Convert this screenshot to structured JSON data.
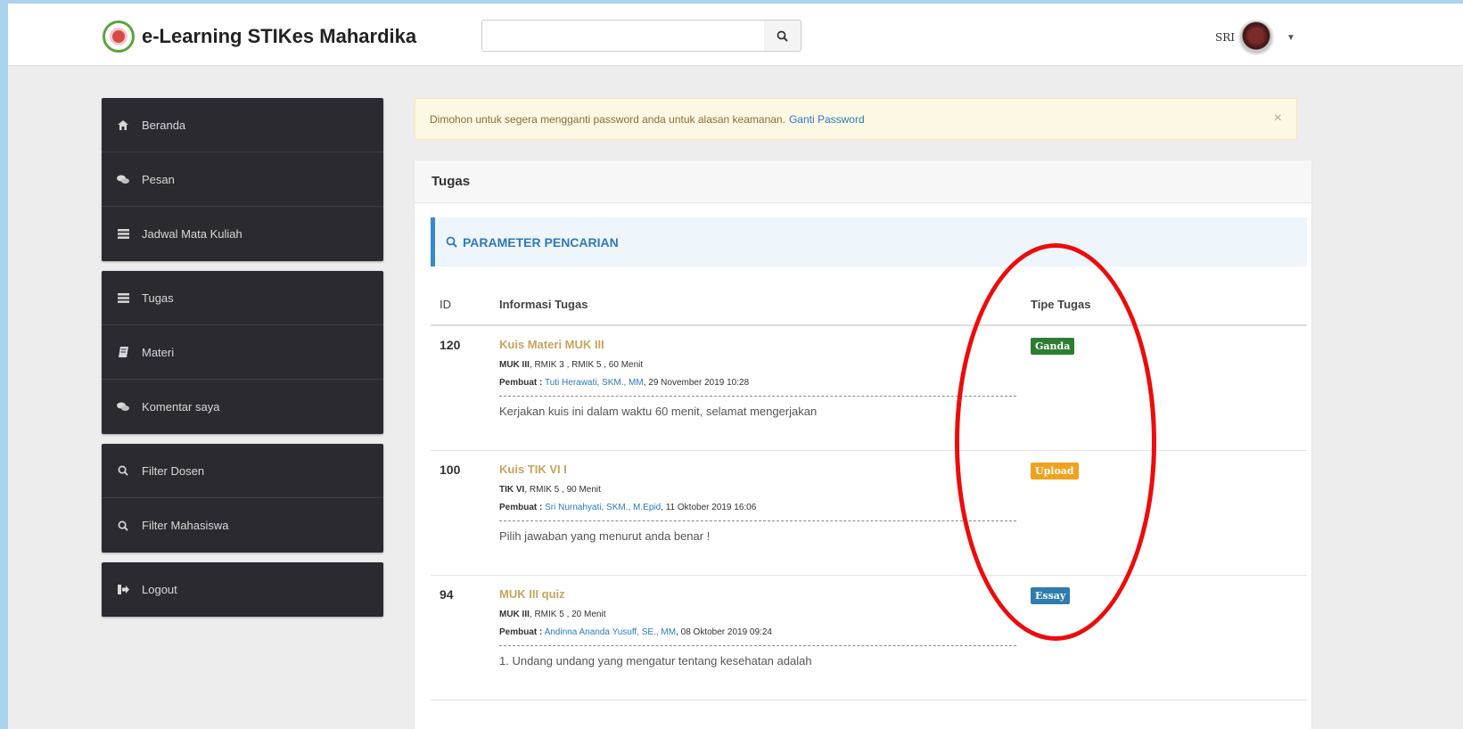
{
  "navbar": {
    "brand": "e-Learning STIKes Mahardika",
    "search_placeholder": "",
    "user_name": "SRI"
  },
  "sidebar": {
    "groups": [
      [
        {
          "label": "Beranda",
          "icon": "home-icon"
        },
        {
          "label": "Pesan",
          "icon": "comments-icon"
        },
        {
          "label": "Jadwal Mata Kuliah",
          "icon": "list-icon"
        }
      ],
      [
        {
          "label": "Tugas",
          "icon": "list-icon"
        },
        {
          "label": "Materi",
          "icon": "book-icon"
        },
        {
          "label": "Komentar saya",
          "icon": "comments-icon"
        }
      ],
      [
        {
          "label": "Filter Dosen",
          "icon": "search-icon"
        },
        {
          "label": "Filter Mahasiswa",
          "icon": "search-icon"
        }
      ],
      [
        {
          "label": "Logout",
          "icon": "sign-out-icon"
        }
      ]
    ]
  },
  "alert": {
    "message": "Dimohon untuk segera mengganti password anda untuk alasan keamanan.",
    "link": "Ganti Password",
    "close": "×"
  },
  "panel": {
    "title": "Tugas",
    "search_parameter": "PARAMETER PENCARIAN",
    "columns": {
      "id": "ID",
      "info": "Informasi Tugas",
      "type": "Tipe Tugas"
    }
  },
  "tasks": [
    {
      "id": "120",
      "title": "Kuis Materi MUK III",
      "course": "MUK III",
      "meta": ", RMIK 3 , RMIK 5 , 60 Menit",
      "creator_label": "Pembuat :",
      "creator": "Tuti Herawati, SKM., MM",
      "created": ", 29 November 2019 10:28",
      "description": "Kerjakan kuis ini dalam waktu 60 menit, selamat mengerjakan",
      "type": "Ganda",
      "type_color": "#2e7d32"
    },
    {
      "id": "100",
      "title": "Kuis TIK VI I",
      "course": "TIK VI",
      "meta": ", RMIK 5 , 90 Menit",
      "creator_label": "Pembuat :",
      "creator": "Sri Nurnahyati, SKM., M.Epid",
      "created": ", 11 Oktober 2019 16:06",
      "description": "Pilih jawaban yang menurut  anda benar !",
      "type": "Upload",
      "type_color": "#f0a21f"
    },
    {
      "id": "94",
      "title": "MUK III quiz",
      "course": "MUK III",
      "meta": ", RMIK 5 , 20 Menit",
      "creator_label": "Pembuat :",
      "creator": "Andinna Ananda Yusuff, SE., MM",
      "created": ", 08 Oktober 2019 09:24",
      "description": "1. Undang undang yang mengatur tentang kesehatan adalah",
      "type": "Essay",
      "type_color": "#2f7cae"
    }
  ],
  "annotation_color": "#ee0b0b"
}
